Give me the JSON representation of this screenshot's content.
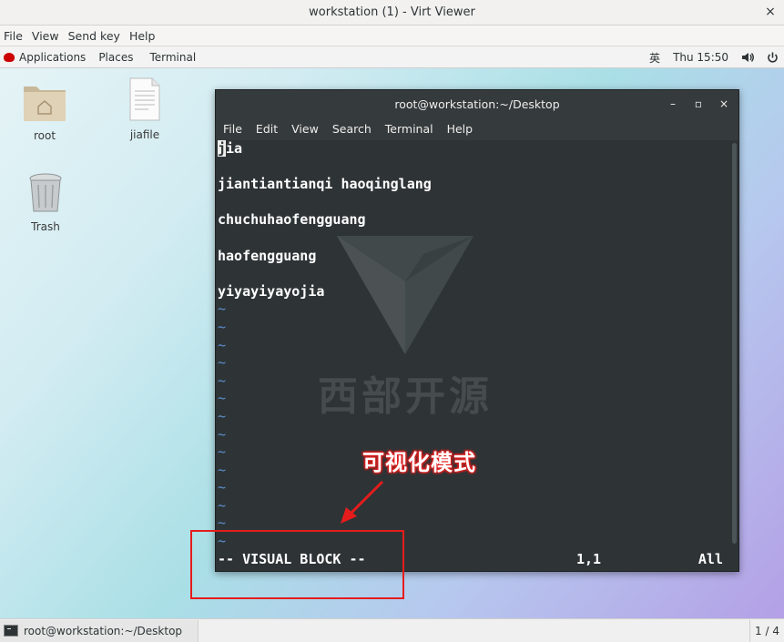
{
  "window": {
    "title": "workstation (1) - Virt Viewer",
    "close_glyph": "×"
  },
  "viewer_menu": [
    "File",
    "View",
    "Send key",
    "Help"
  ],
  "gnome_panel": {
    "applications": "Applications",
    "places": "Places",
    "terminal": "Terminal",
    "input_method": "英",
    "clock": "Thu 15:50",
    "volume_icon": "volume-icon",
    "power_icon": "power-icon"
  },
  "desktop_icons": [
    {
      "label": "root",
      "icon": "home-folder-icon"
    },
    {
      "label": "jiafile",
      "icon": "text-file-icon"
    },
    {
      "label": "Trash",
      "icon": "trash-icon"
    }
  ],
  "terminal": {
    "title": "root@workstation:~/Desktop",
    "controls": [
      "–",
      "▫",
      "×"
    ],
    "menu": [
      "File",
      "Edit",
      "View",
      "Search",
      "Terminal",
      "Help"
    ],
    "cursor_char": "j",
    "first_line_rest": "ia",
    "lines": [
      "",
      "jiantiantianqi haoqinglang",
      "",
      "chuchuhaofengguang",
      "",
      "haofengguang",
      "",
      "yiyayiyayojia"
    ],
    "tilde": "~",
    "tilde_count": 14,
    "status": {
      "mode": "-- VISUAL BLOCK --",
      "position": "1,1",
      "scroll": "All"
    }
  },
  "watermark": "西部开源",
  "annotation": {
    "text": "可视化模式",
    "color": "#e51c1c"
  },
  "taskbar": {
    "item": "root@workstation:~/Desktop",
    "pager": "1 / 4"
  }
}
